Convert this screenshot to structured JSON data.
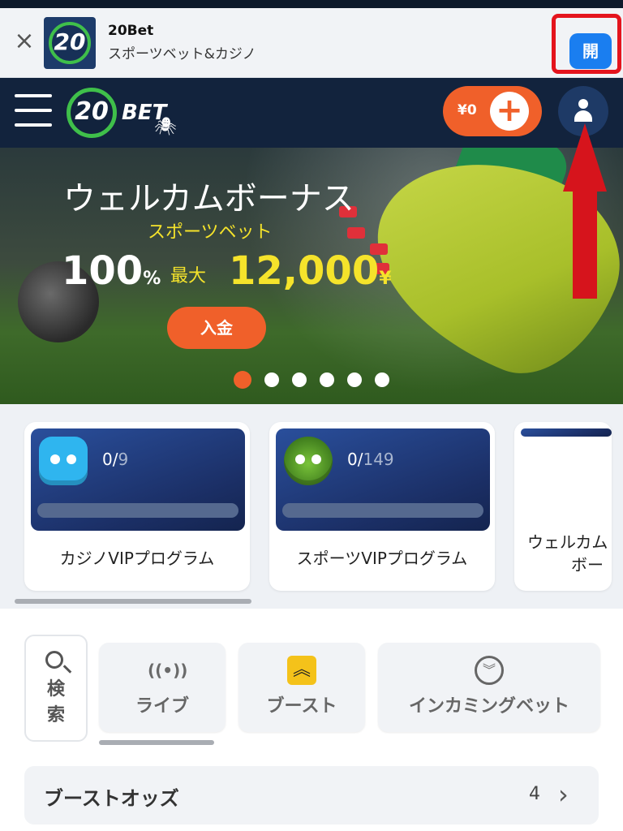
{
  "app_banner": {
    "close_symbol": "×",
    "icon_text": "20",
    "title": "20Bet",
    "subtitle": "スポーツベット&カジノ",
    "open_label": "開"
  },
  "header": {
    "logo_number": "20",
    "logo_text": "BET",
    "balance": "¥0",
    "add_symbol": "+"
  },
  "hero": {
    "title": "ウェルカムボーナス",
    "subtitle": "スポーツベット",
    "percent": "100",
    "percent_unit": "%",
    "max_label": "最大",
    "amount": "12,000",
    "amount_unit": "¥",
    "deposit_label": "入金",
    "slide_count": 6,
    "active_slide": 0
  },
  "vip_cards": [
    {
      "done": "0",
      "total": "9",
      "label": "カジノVIPプログラム"
    },
    {
      "done": "0",
      "total": "149",
      "label": "スポーツVIPプログラム"
    },
    {
      "label_line1": "ウェルカム",
      "label_line2": "ボー"
    }
  ],
  "search": {
    "line1": "検",
    "line2": "索"
  },
  "tabs": [
    {
      "label": "ライブ",
      "icon": "live-signal-icon"
    },
    {
      "label": "ブースト",
      "icon": "boost-chevrons-icon"
    },
    {
      "label": "インカミングベット",
      "icon": "incoming-chevron-icon"
    }
  ],
  "boost_row": {
    "title": "ブーストオッズ",
    "count": "4",
    "chevron": "›"
  },
  "colors": {
    "accent_orange": "#f0602a",
    "header_navy": "#12233d",
    "open_blue": "#1a7ef0",
    "highlight_red": "#e4141d",
    "hero_yellow": "#f5e32b"
  }
}
